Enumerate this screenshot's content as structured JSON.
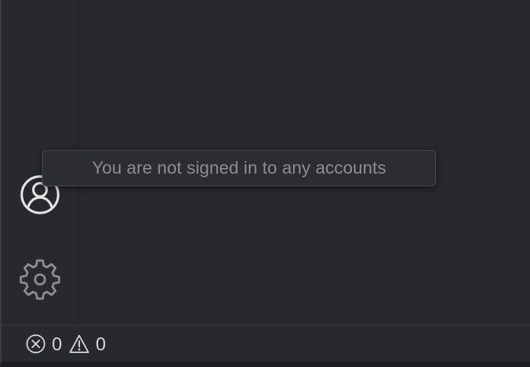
{
  "activity_bar": {
    "accounts": {
      "icon": "account-icon"
    },
    "manage": {
      "icon": "gear-icon"
    }
  },
  "tooltip": {
    "text": "You are not signed in to any accounts"
  },
  "status_bar": {
    "errors": {
      "icon": "error-circle-icon",
      "count": "0"
    },
    "warnings": {
      "icon": "warning-triangle-icon",
      "count": "0"
    }
  },
  "colors": {
    "background": "#28292c",
    "icon": "#d4d4d4",
    "icon_muted": "#8a8b8e",
    "tooltip_text": "#8d8e91"
  }
}
